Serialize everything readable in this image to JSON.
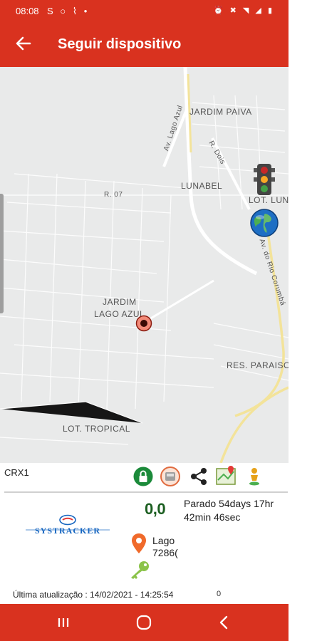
{
  "status_bar": {
    "time": "08:08",
    "left_icons": [
      "S",
      "whatsapp-icon",
      "bluetooth-icon",
      "dot-icon"
    ],
    "right_icons": [
      "alarm-icon",
      "mute-icon",
      "wifi-icon",
      "signal-icon",
      "battery-icon"
    ]
  },
  "appbar": {
    "title": "Seguir dispositivo",
    "back_icon": "arrow-left-icon"
  },
  "map": {
    "labels": {
      "jardim_paiva": "JARDIM PAIVA",
      "lago_azul_av": "Av. Lago Azul",
      "r_dois": "R. Dois",
      "lunabel": "LUNABEL",
      "lot_lun": "LOT. LUN",
      "r07": "R. 07",
      "rio_corumba": "Av. do Rio Corumbá",
      "jardim": "JARDIM",
      "lago_azul": "LAGO AZUL",
      "res_paraiso": "RES. PARAISO",
      "lot_tropical": "LOT. TROPICAL"
    }
  },
  "device": {
    "name": "CRX1",
    "action_icons": [
      "lock-icon",
      "vehicle-info-icon",
      "share-icon",
      "map-route-icon",
      "person-pin-icon"
    ],
    "brand": "SYSTRACKER",
    "speed": "0,0",
    "state_text": "Parado 54days 17hr 42min 46sec",
    "address_line1": "Lago",
    "address_line2": "7286(",
    "last_update": "Última atualização : 14/02/2021 - 14:25:54",
    "counter": "0"
  },
  "colors": {
    "brand_red": "#d9321f",
    "speed_green": "#1b5e20",
    "pin_orange": "#f06a2b",
    "key_green": "#8bc34a",
    "map_bg": "#e9eaea",
    "road_yellow": "#f3e39a"
  }
}
